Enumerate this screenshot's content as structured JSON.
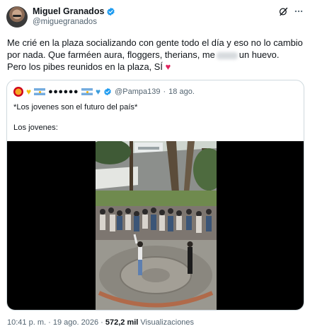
{
  "author": {
    "display_name": "Miguel Granados",
    "handle": "@miguegranados"
  },
  "tweet": {
    "line1": "Me crié en la plaza socializando con gente todo el día y eso no lo cambio",
    "line2": "por nada. Que farméen aura, floggers, therians, me",
    "line2_after": "un huevo.",
    "line3": "Pero los pibes reunidos en la plaza, SÍ",
    "heart": "♥"
  },
  "quote": {
    "name_masked": "●●●●●●",
    "handle": "@Pampa139",
    "separator": "·",
    "time": "18 ago.",
    "text1": "*Los jovenes son el futuro del país*",
    "text2": "Los jovenes:"
  },
  "meta": {
    "time": "10:41 p. m.",
    "sep1": "·",
    "date": "19 ago. 2026",
    "sep2": "·",
    "views_count": "572,2 mil",
    "views_label": "Visualizaciones"
  },
  "colors": {
    "verified": "#1d9bf0",
    "heart": "#e0245e",
    "border": "#cfd9de",
    "secondary_text": "#536471"
  }
}
